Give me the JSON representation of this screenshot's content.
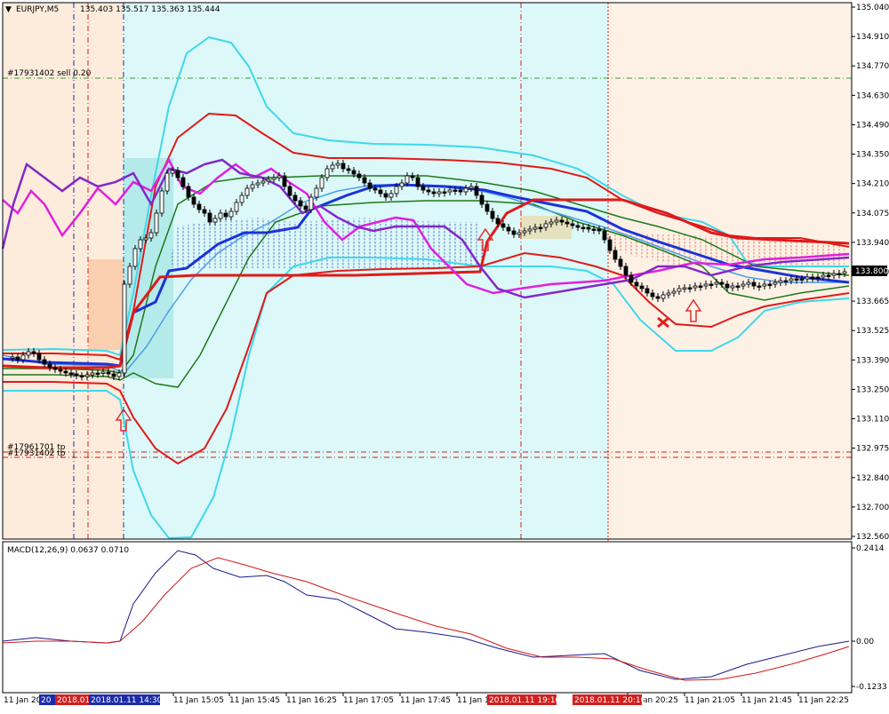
{
  "window": {
    "symbol_tf": "EURJPY,M5",
    "ohlc": "135.403 135.517 135.363 135.444",
    "collapse_glyph": "▼"
  },
  "orders": {
    "sell_line_label": "#17931402 sell 0.20",
    "tp_label_1": "#17961701 tp",
    "tp_label_2": "#17931402 tp"
  },
  "price_axis": {
    "ticks": [
      "135.040",
      "134.910",
      "134.770",
      "134.630",
      "134.490",
      "134.350",
      "134.210",
      "134.075",
      "133.940",
      "133.800",
      "133.665",
      "133.525",
      "133.390",
      "133.250",
      "133.110",
      "132.975",
      "132.840",
      "132.700",
      "132.560"
    ],
    "current": "133.800"
  },
  "macd": {
    "label": "MACD(12,26,9) 0.0637 0.0710",
    "ticks": [
      "0.2414",
      "0.00",
      "-0.1233"
    ]
  },
  "time_axis": {
    "labels": [
      "11 Jan 20",
      "11 Jan 15:05",
      "11 Jan 15:45",
      "11 Jan 16:25",
      "11 Jan 17:05",
      "11 Jan 17:45",
      "11 Jan 18:2",
      "11 Jan 20:25",
      "11 Jan 21:05",
      "11 Jan 21:45",
      "11 Jan 22:25"
    ],
    "marker_a": "20",
    "marker_b": "2018.01.",
    "marker_c": "2018.01.11 14:30",
    "marker_d": "2018.01.11 19:10",
    "marker_e": "2018.01.11 20:10"
  },
  "colors": {
    "bg_left": "#fdecdc",
    "bg_mid": "#dcf8f8",
    "bg_right": "#fdf1e5",
    "bollinger_outer": "#3fd8ea",
    "bollinger_mid": "#e01a1a",
    "bollinger_inner": "#1a7a1a",
    "ma_blue": "#1c33d8",
    "ma_light": "#4c9ee8",
    "rsi_magenta": "#e020e0",
    "rsi_purple": "#8428c8",
    "macd_main": "#1a1a8c",
    "macd_signal": "#d01818",
    "arrow_red": "#e03030"
  },
  "chart_data": {
    "type": "candlestick",
    "symbol": "EURJPY",
    "timeframe": "M5",
    "price_range": [
      132.56,
      135.04
    ],
    "macd_range": [
      -0.1233,
      0.2414
    ],
    "last_ohlc": {
      "open": 135.403,
      "high": 135.517,
      "low": 135.363,
      "close": 135.444
    },
    "macd_values": {
      "main": 0.0637,
      "signal": 0.071
    }
  }
}
